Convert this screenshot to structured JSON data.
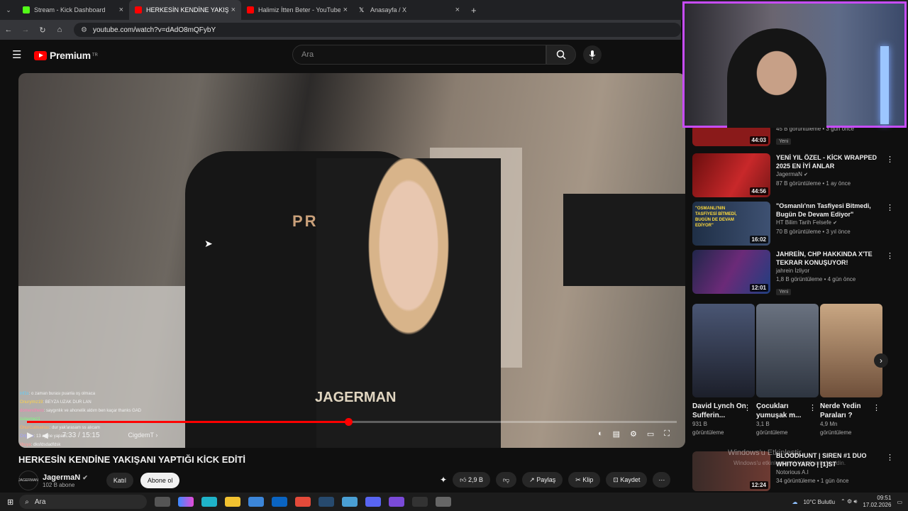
{
  "browser": {
    "tabs": [
      {
        "label": "Stream - Kick Dashboard",
        "color": "#53fc18"
      },
      {
        "label": "HERKESİN KENDİNE YAKIŞANI",
        "color": "#ff0000"
      },
      {
        "label": "Halimiz İtten Beter - YouTube",
        "color": "#ff0000"
      },
      {
        "label": "Anasayfa / X",
        "color": "#ffffff"
      }
    ],
    "url": "youtube.com/watch?v=dAdO8mQFybY"
  },
  "youtube": {
    "logo_text": "Premium",
    "logo_region": "TR",
    "search_placeholder": "Ara"
  },
  "video": {
    "chair_brand": "PRIME",
    "watermark": "JAGERMAN",
    "chat": [
      {
        "user": "inf1s",
        "msg": "o zaman burası puanla oş olmaca",
        "color": "#5fd0ff"
      },
      {
        "user": "Onurylmz19",
        "msg": "BEYZA UZAK DUR LAN",
        "color": "#ffd24a"
      },
      {
        "user": "domendhero",
        "msg": "saygınlık ve ahonelik aldım ben kaçar thanks GAD",
        "color": "#ff7eb3"
      },
      {
        "user": "zulasmez1",
        "msg": "",
        "color": "#7cff7c"
      },
      {
        "user": "OnurCulmaktas",
        "msg": "dur yak'arasam ss alıcam",
        "color": "#ffb15c"
      },
      {
        "user": "OrlgMe",
        "msg": "13 ay ne yapam",
        "color": "#a0a0ff"
      },
      {
        "user": "ilbuya",
        "msg": "dksfdsdadfdsk",
        "color": "#ff9a9a"
      }
    ],
    "time_current": "7:33",
    "time_total": "15:15",
    "time_display": "7:33 / 15:15",
    "chapter": "CigdemT",
    "progress_fraction": 0.4945,
    "title": "HERKESİN KENDİNE YAKIŞANI YAPTIĞI KİCK EDİTİ",
    "channel": {
      "name": "JagermaN",
      "subs": "102 B abone",
      "avatar_text": "JAGERMAN"
    },
    "buttons": {
      "join": "Katıl",
      "subscribe": "Abone ol",
      "likes": "2,9 B",
      "share": "Paylaş",
      "clip": "Klip",
      "save": "Kaydet"
    }
  },
  "recommendations": [
    {
      "title": "",
      "meta1": "45 B görüntüleme • 3 gün önce",
      "badge": "Yeni",
      "duration": "44:03",
      "thumb": "#8a1a1a"
    },
    {
      "title": "YENİ YIL ÖZEL - KİCK WRAPPED 2025 EN İYİ ANLAR",
      "meta1": "JagermaN",
      "meta2": "87 B görüntüleme • 1 ay önce",
      "duration": "44:56",
      "thumb": "#b0201c"
    },
    {
      "title": "\"Osmanlı'nın Tasfiyesi Bitmedi, Bugün De Devam Ediyor\"",
      "meta1": "HT Bilim Tarih Felsefe",
      "meta2": "70 B görüntüleme • 3 yıl önce",
      "duration": "16:02",
      "thumb": "#2a3b55",
      "thumb_text": "\"OSMANLI'NIN TASFİYESİ BİTMEDİ, BUGÜN DE DEVAM EDİYOR\""
    },
    {
      "title": "JAHREİN, CHP HAKKINDA X'TE TEKRAR KONUŞUYOR!",
      "meta1": "jahrein İzliyor",
      "meta2": "1,8 B görüntüleme • 4 gün önce",
      "badge": "Yeni",
      "duration": "12:01",
      "thumb": "#3a2a6a"
    }
  ],
  "shorts": [
    {
      "title": "David Lynch On Sufferin...",
      "views": "931 B",
      "unit": "görüntüleme",
      "thumb": "#3b4254"
    },
    {
      "title": "Çocukları yumuşak m...",
      "views": "3,1 B",
      "unit": "görüntüleme",
      "thumb": "#4a5560"
    },
    {
      "title": "Nerde Yedin Paraları ?",
      "views": "4,9 Mn",
      "unit": "görüntüleme",
      "thumb": "#7b6a58"
    }
  ],
  "last_rec": {
    "title": "BLOODHUNT | SIREN #1 DUO WHITOYARO | [1]ST",
    "meta1": "Notorious A.I",
    "meta2": "34 görüntüleme • 1 gün önce",
    "duration": "12:24"
  },
  "windows": {
    "watermark_title": "Windows'u Etkinleştir",
    "watermark_sub": "Windows'u etkinleştirmek için Ayarlar'a gidin.",
    "search": "Ara",
    "weather": "10°C Bulutlu",
    "time": "09:51",
    "date": "17.02.2026"
  },
  "webcam": {
    "border_color": "#c84cff"
  }
}
